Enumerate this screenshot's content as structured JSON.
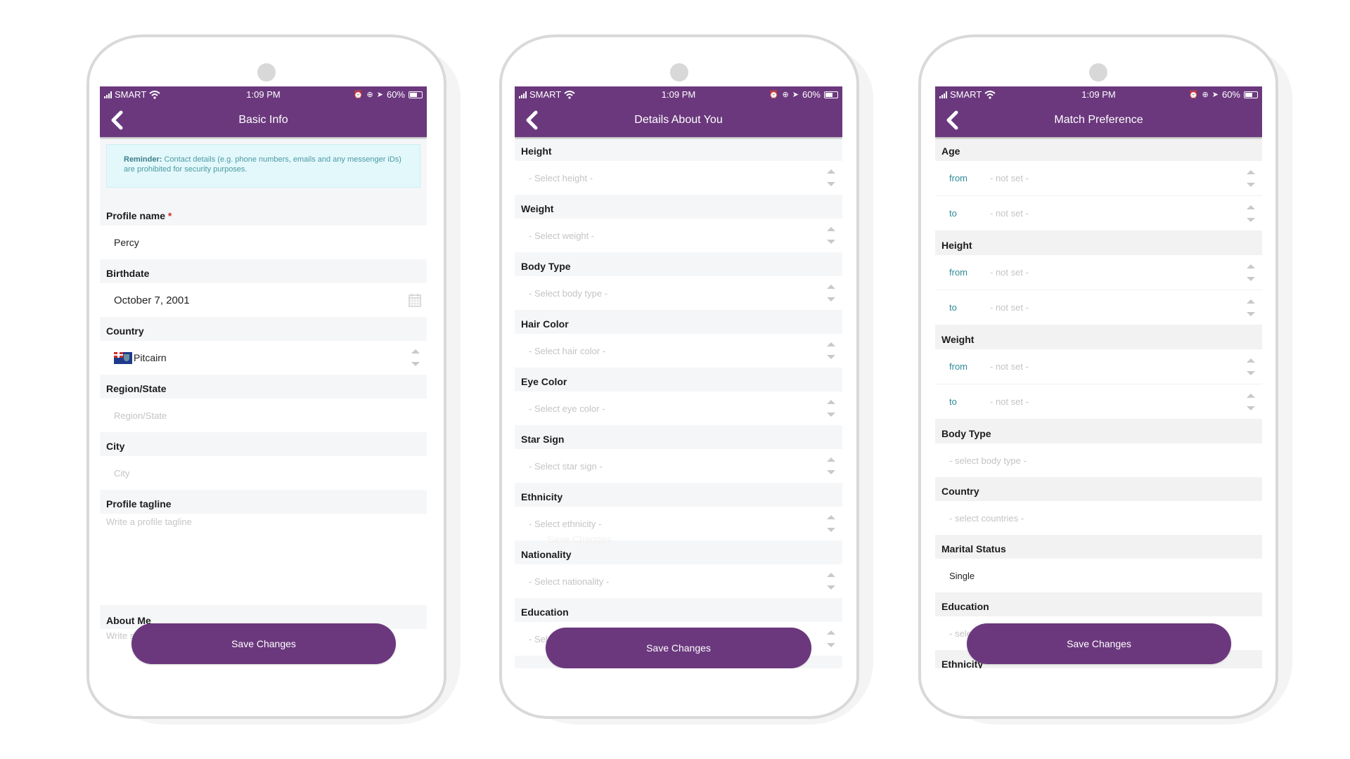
{
  "status_bar": {
    "carrier": "SMART",
    "time": "1:09 PM",
    "battery_text": "60%",
    "battery_level_percent": 60
  },
  "colors": {
    "brand_purple": "#6b387d",
    "accent_teal": "#2e8a96",
    "required_star": "#d0312d",
    "reminder_bg": "#e3f8fb"
  },
  "screens": {
    "basic_info": {
      "title": "Basic Info",
      "reminder_bold": "Reminder:",
      "reminder_text": " Contact details (e.g. phone numbers, emails and any messenger iDs) are prohibited for security purposes.",
      "profile_name_label": "Profile name",
      "required_marker": "*",
      "profile_name_value": "Percy",
      "birthdate_label": "Birthdate",
      "birthdate_value": "October 7, 2001",
      "country_label": "Country",
      "country_value": "Pitcairn",
      "region_label": "Region/State",
      "region_placeholder": "Region/State",
      "city_label": "City",
      "city_placeholder": "City",
      "tagline_label": "Profile tagline",
      "tagline_placeholder": "Write a profile tagline",
      "about_label": "About Me",
      "about_placeholder": "Write something about yourself",
      "save_label": "Save Changes"
    },
    "details_about_you": {
      "title": "Details About You",
      "fields": [
        {
          "label": "Height",
          "placeholder": "- Select height -"
        },
        {
          "label": "Weight",
          "placeholder": "- Select weight -"
        },
        {
          "label": "Body Type",
          "placeholder": "- Select body type -"
        },
        {
          "label": "Hair Color",
          "placeholder": "- Select hair color -"
        },
        {
          "label": "Eye Color",
          "placeholder": "- Select eye color -"
        },
        {
          "label": "Star Sign",
          "placeholder": "- Select star sign -"
        },
        {
          "label": "Ethnicity",
          "placeholder": "- Select ethnicity -"
        },
        {
          "label": "Nationality",
          "placeholder": "- Select nationality -"
        },
        {
          "label": "Education",
          "placeholder": "- Select education -"
        }
      ],
      "ghost_text": "Save Changes",
      "save_label": "Save Changes"
    },
    "match_preference": {
      "title": "Match Preference",
      "ranges": [
        {
          "label": "Age",
          "from_key": "from",
          "from_value": "- not set -",
          "to_key": "to",
          "to_value": "- not set -"
        },
        {
          "label": "Height",
          "from_key": "from",
          "from_value": "- not set -",
          "to_key": "to",
          "to_value": "- not set -"
        },
        {
          "label": "Weight",
          "from_key": "from",
          "from_value": "- not set -",
          "to_key": "to",
          "to_value": "- not set -"
        }
      ],
      "body_type_label": "Body Type",
      "body_type_placeholder": "- select body type -",
      "country_label": "Country",
      "country_placeholder": "- select countries -",
      "marital_label": "Marital Status",
      "marital_value": "Single",
      "education_label": "Education",
      "education_placeholder": "- select education -",
      "ethnicity_label": "Ethnicity",
      "save_label": "Save Changes"
    }
  }
}
